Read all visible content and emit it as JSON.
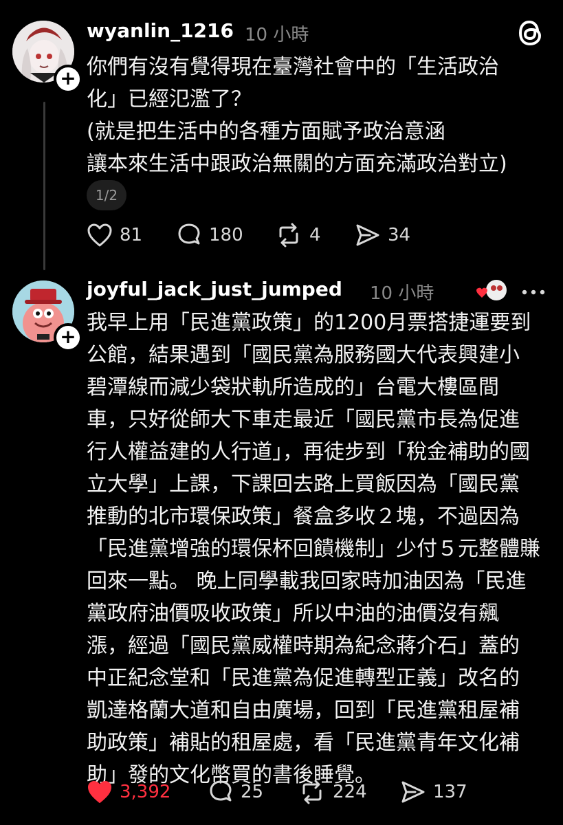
{
  "post1": {
    "username": "wyanlin_1216",
    "time": "10 小時",
    "text": "你們有沒有覺得現在臺灣社會中的「生活政治\n化」已經氾濫了？\n(就是把生活中的各種方面賦予政治意涵\n讓本來生活中跟政治無關的方面充滿政治對立)",
    "page_indicator": "1/2",
    "likes": "81",
    "comments": "180",
    "reposts": "4",
    "shares": "34"
  },
  "post2": {
    "username": "joyful_jack_just_jumped",
    "time": "10 小時",
    "text": "我早上用「民進黨政策」的1200月票搭捷運要到\n公館，結果遇到「國民黨為服務國大代表興建小\n碧潭線而減少袋狀軌所造成的」台電大樓區間\n車，只好從師大下車走最近「國民黨市長為促進\n行人權益建的人行道」，再徒步到「稅金補助的國\n立大學」上課，下課回去路上買飯因為「國民黨\n推動的北市環保政策」餐盒多收２塊，不過因為\n「民進黨增強的環保杯回饋機制」少付５元整體賺\n回來一點。 晚上同學載我回家時加油因為「民進\n黨政府油價吸收政策」所以中油的油價沒有飆\n漲，經過「國民黨威權時期為紀念蔣介石」蓋的\n中正紀念堂和「民進黨為促進轉型正義」改名的\n凱達格蘭大道和自由廣場，回到「民進黨租屋補\n助政策」補貼的租屋處，看「民進黨青年文化補\n助」發的文化幣買的書後睡覺。",
    "likes": "3,392",
    "comments": "25",
    "reposts": "224",
    "shares": "137"
  },
  "icons": [
    "threads-logo-icon",
    "more-options-icon",
    "heart-icon",
    "comment-icon",
    "repost-icon",
    "share-icon",
    "follow-plus-icon"
  ],
  "colors": {
    "background": "#000000",
    "liked": "#ff3040",
    "muted": "#8a8a8a"
  }
}
